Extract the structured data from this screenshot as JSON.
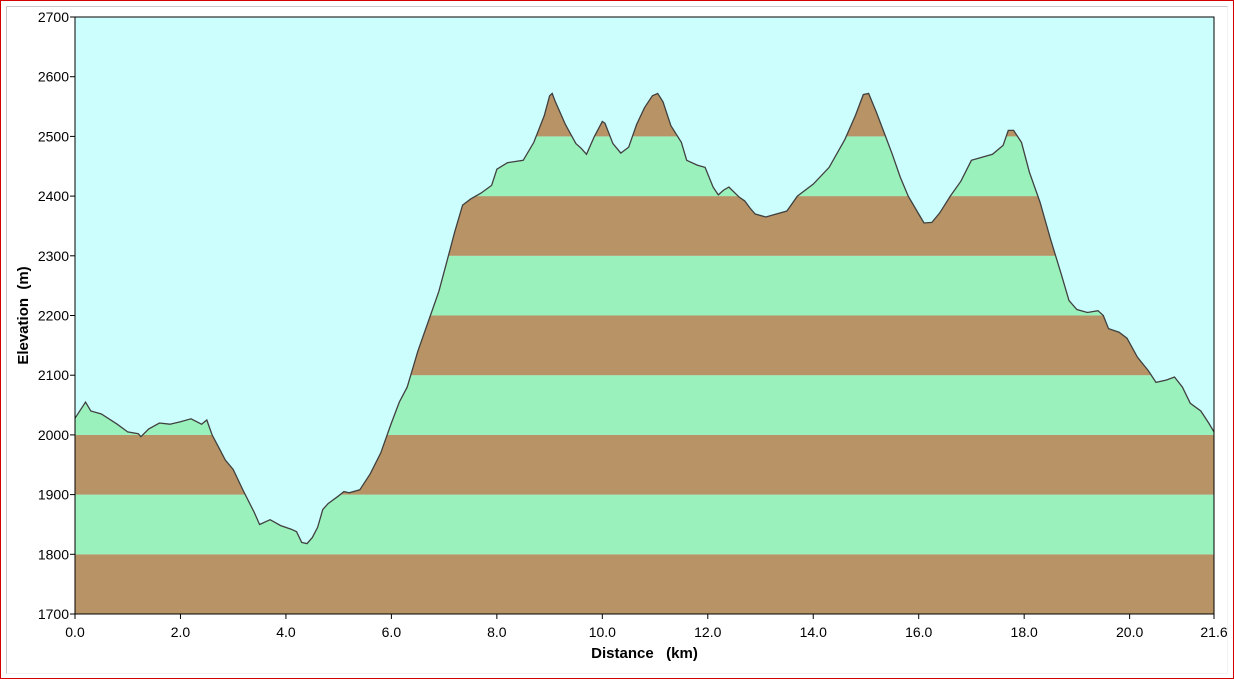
{
  "chart_data": {
    "type": "area",
    "xlabel": "Distance   (km)",
    "ylabel": "Elevation  (m)",
    "xlim": [
      0,
      21.6
    ],
    "ylim": [
      1700,
      2700
    ],
    "x_ticks": [
      "0.0",
      "2.0",
      "4.0",
      "6.0",
      "8.0",
      "10.0",
      "12.0",
      "14.0",
      "16.0",
      "18.0",
      "20.0",
      "21.6"
    ],
    "x_tick_values": [
      0,
      2,
      4,
      6,
      8,
      10,
      12,
      14,
      16,
      18,
      20,
      21.6
    ],
    "y_ticks": [
      "1700",
      "1800",
      "1900",
      "2000",
      "2100",
      "2200",
      "2300",
      "2400",
      "2500",
      "2600",
      "2700"
    ],
    "y_tick_values": [
      1700,
      1800,
      1900,
      2000,
      2100,
      2200,
      2300,
      2400,
      2500,
      2600,
      2700
    ],
    "band_interval": 100,
    "colors": {
      "sky": "#ccfefe",
      "band_dark": "#b79366",
      "band_light": "#9af1bc",
      "profile_line": "#404040"
    },
    "points": [
      [
        0.0,
        2028
      ],
      [
        0.15,
        2048
      ],
      [
        0.2,
        2055
      ],
      [
        0.3,
        2040
      ],
      [
        0.5,
        2035
      ],
      [
        0.8,
        2018
      ],
      [
        1.0,
        2005
      ],
      [
        1.2,
        2002
      ],
      [
        1.25,
        1997
      ],
      [
        1.4,
        2010
      ],
      [
        1.6,
        2020
      ],
      [
        1.8,
        2018
      ],
      [
        2.0,
        2022
      ],
      [
        2.2,
        2027
      ],
      [
        2.4,
        2018
      ],
      [
        2.5,
        2025
      ],
      [
        2.6,
        2000
      ],
      [
        2.75,
        1975
      ],
      [
        2.85,
        1958
      ],
      [
        3.0,
        1942
      ],
      [
        3.2,
        1905
      ],
      [
        3.4,
        1870
      ],
      [
        3.5,
        1850
      ],
      [
        3.7,
        1858
      ],
      [
        3.9,
        1848
      ],
      [
        4.1,
        1842
      ],
      [
        4.2,
        1838
      ],
      [
        4.3,
        1820
      ],
      [
        4.4,
        1818
      ],
      [
        4.5,
        1828
      ],
      [
        4.6,
        1845
      ],
      [
        4.7,
        1875
      ],
      [
        4.8,
        1885
      ],
      [
        5.0,
        1898
      ],
      [
        5.1,
        1905
      ],
      [
        5.2,
        1903
      ],
      [
        5.4,
        1908
      ],
      [
        5.6,
        1935
      ],
      [
        5.8,
        1970
      ],
      [
        6.0,
        2020
      ],
      [
        6.15,
        2055
      ],
      [
        6.3,
        2080
      ],
      [
        6.5,
        2140
      ],
      [
        6.7,
        2190
      ],
      [
        6.9,
        2240
      ],
      [
        7.05,
        2290
      ],
      [
        7.2,
        2340
      ],
      [
        7.35,
        2385
      ],
      [
        7.5,
        2395
      ],
      [
        7.7,
        2405
      ],
      [
        7.9,
        2418
      ],
      [
        8.0,
        2445
      ],
      [
        8.2,
        2456
      ],
      [
        8.5,
        2460
      ],
      [
        8.7,
        2490
      ],
      [
        8.9,
        2535
      ],
      [
        9.0,
        2568
      ],
      [
        9.05,
        2572
      ],
      [
        9.1,
        2560
      ],
      [
        9.3,
        2520
      ],
      [
        9.5,
        2488
      ],
      [
        9.6,
        2480
      ],
      [
        9.7,
        2470
      ],
      [
        9.85,
        2500
      ],
      [
        10.0,
        2525
      ],
      [
        10.05,
        2522
      ],
      [
        10.2,
        2488
      ],
      [
        10.35,
        2472
      ],
      [
        10.5,
        2482
      ],
      [
        10.65,
        2520
      ],
      [
        10.8,
        2548
      ],
      [
        10.95,
        2568
      ],
      [
        11.05,
        2572
      ],
      [
        11.15,
        2558
      ],
      [
        11.3,
        2518
      ],
      [
        11.5,
        2490
      ],
      [
        11.6,
        2460
      ],
      [
        11.8,
        2452
      ],
      [
        11.95,
        2448
      ],
      [
        12.1,
        2415
      ],
      [
        12.2,
        2402
      ],
      [
        12.3,
        2410
      ],
      [
        12.4,
        2415
      ],
      [
        12.6,
        2398
      ],
      [
        12.7,
        2392
      ],
      [
        12.8,
        2380
      ],
      [
        12.9,
        2370
      ],
      [
        13.1,
        2365
      ],
      [
        13.3,
        2370
      ],
      [
        13.5,
        2375
      ],
      [
        13.7,
        2400
      ],
      [
        14.0,
        2420
      ],
      [
        14.3,
        2448
      ],
      [
        14.6,
        2495
      ],
      [
        14.8,
        2535
      ],
      [
        14.95,
        2570
      ],
      [
        15.05,
        2572
      ],
      [
        15.2,
        2540
      ],
      [
        15.35,
        2505
      ],
      [
        15.5,
        2470
      ],
      [
        15.65,
        2432
      ],
      [
        15.8,
        2400
      ],
      [
        16.0,
        2370
      ],
      [
        16.1,
        2355
      ],
      [
        16.25,
        2356
      ],
      [
        16.4,
        2372
      ],
      [
        16.6,
        2400
      ],
      [
        16.8,
        2425
      ],
      [
        17.0,
        2460
      ],
      [
        17.2,
        2465
      ],
      [
        17.4,
        2470
      ],
      [
        17.6,
        2485
      ],
      [
        17.7,
        2510
      ],
      [
        17.8,
        2510
      ],
      [
        17.95,
        2490
      ],
      [
        18.1,
        2440
      ],
      [
        18.3,
        2390
      ],
      [
        18.5,
        2328
      ],
      [
        18.7,
        2270
      ],
      [
        18.85,
        2225
      ],
      [
        19.0,
        2210
      ],
      [
        19.2,
        2205
      ],
      [
        19.4,
        2208
      ],
      [
        19.5,
        2200
      ],
      [
        19.6,
        2178
      ],
      [
        19.8,
        2172
      ],
      [
        19.95,
        2162
      ],
      [
        20.15,
        2130
      ],
      [
        20.35,
        2108
      ],
      [
        20.5,
        2088
      ],
      [
        20.7,
        2092
      ],
      [
        20.85,
        2097
      ],
      [
        21.0,
        2080
      ],
      [
        21.15,
        2053
      ],
      [
        21.35,
        2040
      ],
      [
        21.5,
        2020
      ],
      [
        21.6,
        2005
      ]
    ]
  }
}
